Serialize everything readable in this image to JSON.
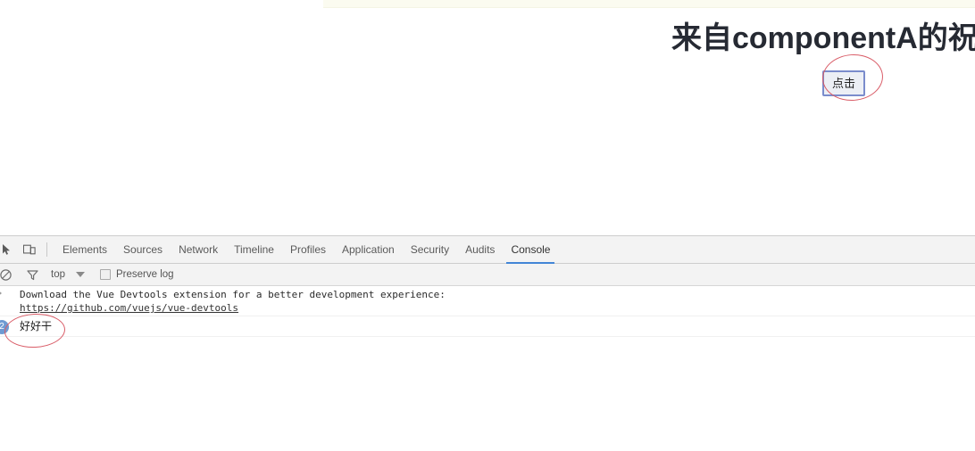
{
  "page": {
    "heading": "来自componentA的祝",
    "button_label": "点击"
  },
  "devtools": {
    "icons": {
      "inspect": "inspect-element-icon",
      "device_toggle": "device-toolbar-icon",
      "clear_console": "clear-console-icon",
      "filter": "filter-funnel-icon"
    },
    "tabs": [
      {
        "label": "Elements",
        "active": false
      },
      {
        "label": "Sources",
        "active": false
      },
      {
        "label": "Network",
        "active": false
      },
      {
        "label": "Timeline",
        "active": false
      },
      {
        "label": "Profiles",
        "active": false
      },
      {
        "label": "Application",
        "active": false
      },
      {
        "label": "Security",
        "active": false
      },
      {
        "label": "Audits",
        "active": false
      },
      {
        "label": "Console",
        "active": true
      }
    ],
    "console_toolbar": {
      "context": "top",
      "preserve_log_label": "Preserve log",
      "preserve_log_checked": false
    },
    "console_messages": [
      {
        "text": "Download the Vue Devtools extension for a better development experience:",
        "link": "https://github.com/vuejs/vue-devtools"
      },
      {
        "text": "好好干",
        "count": "2"
      }
    ]
  },
  "colors": {
    "accent_tab_underline": "#4285d6",
    "annotation_red": "#d95c67",
    "button_border": "#7a8ccc",
    "badge_blue": "#6e9ad2"
  }
}
